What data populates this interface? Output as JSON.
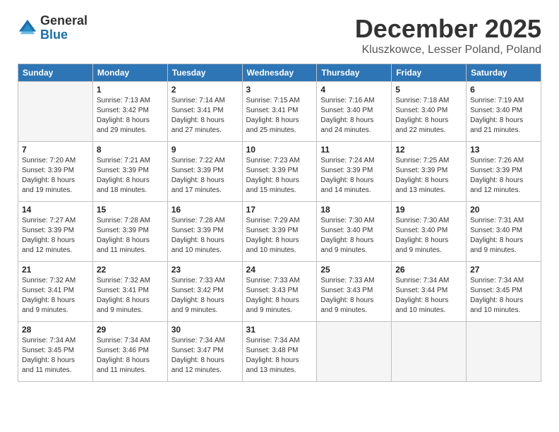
{
  "logo": {
    "general": "General",
    "blue": "Blue"
  },
  "header": {
    "month": "December 2025",
    "location": "Kluszkowce, Lesser Poland, Poland"
  },
  "days_of_week": [
    "Sunday",
    "Monday",
    "Tuesday",
    "Wednesday",
    "Thursday",
    "Friday",
    "Saturday"
  ],
  "weeks": [
    [
      {
        "day": "",
        "info": ""
      },
      {
        "day": "1",
        "info": "Sunrise: 7:13 AM\nSunset: 3:42 PM\nDaylight: 8 hours\nand 29 minutes."
      },
      {
        "day": "2",
        "info": "Sunrise: 7:14 AM\nSunset: 3:41 PM\nDaylight: 8 hours\nand 27 minutes."
      },
      {
        "day": "3",
        "info": "Sunrise: 7:15 AM\nSunset: 3:41 PM\nDaylight: 8 hours\nand 25 minutes."
      },
      {
        "day": "4",
        "info": "Sunrise: 7:16 AM\nSunset: 3:40 PM\nDaylight: 8 hours\nand 24 minutes."
      },
      {
        "day": "5",
        "info": "Sunrise: 7:18 AM\nSunset: 3:40 PM\nDaylight: 8 hours\nand 22 minutes."
      },
      {
        "day": "6",
        "info": "Sunrise: 7:19 AM\nSunset: 3:40 PM\nDaylight: 8 hours\nand 21 minutes."
      }
    ],
    [
      {
        "day": "7",
        "info": "Sunrise: 7:20 AM\nSunset: 3:39 PM\nDaylight: 8 hours\nand 19 minutes."
      },
      {
        "day": "8",
        "info": "Sunrise: 7:21 AM\nSunset: 3:39 PM\nDaylight: 8 hours\nand 18 minutes."
      },
      {
        "day": "9",
        "info": "Sunrise: 7:22 AM\nSunset: 3:39 PM\nDaylight: 8 hours\nand 17 minutes."
      },
      {
        "day": "10",
        "info": "Sunrise: 7:23 AM\nSunset: 3:39 PM\nDaylight: 8 hours\nand 15 minutes."
      },
      {
        "day": "11",
        "info": "Sunrise: 7:24 AM\nSunset: 3:39 PM\nDaylight: 8 hours\nand 14 minutes."
      },
      {
        "day": "12",
        "info": "Sunrise: 7:25 AM\nSunset: 3:39 PM\nDaylight: 8 hours\nand 13 minutes."
      },
      {
        "day": "13",
        "info": "Sunrise: 7:26 AM\nSunset: 3:39 PM\nDaylight: 8 hours\nand 12 minutes."
      }
    ],
    [
      {
        "day": "14",
        "info": "Sunrise: 7:27 AM\nSunset: 3:39 PM\nDaylight: 8 hours\nand 12 minutes."
      },
      {
        "day": "15",
        "info": "Sunrise: 7:28 AM\nSunset: 3:39 PM\nDaylight: 8 hours\nand 11 minutes."
      },
      {
        "day": "16",
        "info": "Sunrise: 7:28 AM\nSunset: 3:39 PM\nDaylight: 8 hours\nand 10 minutes."
      },
      {
        "day": "17",
        "info": "Sunrise: 7:29 AM\nSunset: 3:39 PM\nDaylight: 8 hours\nand 10 minutes."
      },
      {
        "day": "18",
        "info": "Sunrise: 7:30 AM\nSunset: 3:40 PM\nDaylight: 8 hours\nand 9 minutes."
      },
      {
        "day": "19",
        "info": "Sunrise: 7:30 AM\nSunset: 3:40 PM\nDaylight: 8 hours\nand 9 minutes."
      },
      {
        "day": "20",
        "info": "Sunrise: 7:31 AM\nSunset: 3:40 PM\nDaylight: 8 hours\nand 9 minutes."
      }
    ],
    [
      {
        "day": "21",
        "info": "Sunrise: 7:32 AM\nSunset: 3:41 PM\nDaylight: 8 hours\nand 9 minutes."
      },
      {
        "day": "22",
        "info": "Sunrise: 7:32 AM\nSunset: 3:41 PM\nDaylight: 8 hours\nand 9 minutes."
      },
      {
        "day": "23",
        "info": "Sunrise: 7:33 AM\nSunset: 3:42 PM\nDaylight: 8 hours\nand 9 minutes."
      },
      {
        "day": "24",
        "info": "Sunrise: 7:33 AM\nSunset: 3:43 PM\nDaylight: 8 hours\nand 9 minutes."
      },
      {
        "day": "25",
        "info": "Sunrise: 7:33 AM\nSunset: 3:43 PM\nDaylight: 8 hours\nand 9 minutes."
      },
      {
        "day": "26",
        "info": "Sunrise: 7:34 AM\nSunset: 3:44 PM\nDaylight: 8 hours\nand 10 minutes."
      },
      {
        "day": "27",
        "info": "Sunrise: 7:34 AM\nSunset: 3:45 PM\nDaylight: 8 hours\nand 10 minutes."
      }
    ],
    [
      {
        "day": "28",
        "info": "Sunrise: 7:34 AM\nSunset: 3:45 PM\nDaylight: 8 hours\nand 11 minutes."
      },
      {
        "day": "29",
        "info": "Sunrise: 7:34 AM\nSunset: 3:46 PM\nDaylight: 8 hours\nand 11 minutes."
      },
      {
        "day": "30",
        "info": "Sunrise: 7:34 AM\nSunset: 3:47 PM\nDaylight: 8 hours\nand 12 minutes."
      },
      {
        "day": "31",
        "info": "Sunrise: 7:34 AM\nSunset: 3:48 PM\nDaylight: 8 hours\nand 13 minutes."
      },
      {
        "day": "",
        "info": ""
      },
      {
        "day": "",
        "info": ""
      },
      {
        "day": "",
        "info": ""
      }
    ]
  ]
}
